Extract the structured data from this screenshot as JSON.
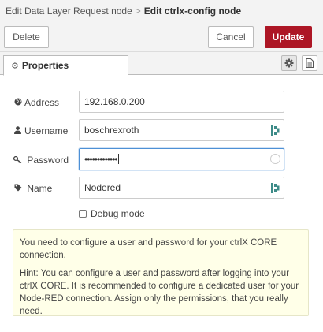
{
  "breadcrumb": {
    "parent": "Edit Data Layer Request node",
    "separator": ">",
    "current": "Edit ctrlx-config node"
  },
  "toolbar": {
    "delete_label": "Delete",
    "cancel_label": "Cancel",
    "update_label": "Update"
  },
  "tabs": {
    "properties_label": "Properties"
  },
  "form": {
    "address_label": "Address",
    "address_value": "192.168.0.200",
    "username_label": "Username",
    "username_value": "boschrexroth",
    "password_label": "Password",
    "password_value": "•••••••••••••",
    "name_label": "Name",
    "name_value": "Nodered",
    "debug_label": "Debug mode"
  },
  "info": {
    "line1": "You need to configure a user and password for your ctrlX CORE connection.",
    "line2": "Hint: You can configure a user and password after logging into your ctrlX CORE. It is recommended to configure a dedicated user for your Node-RED connection. Assign only the permissions, that you really need."
  },
  "icons": {
    "address": "globe-icon",
    "username": "user-icon",
    "password": "key-icon",
    "name": "tag-icon",
    "tab": "gear-icon",
    "settings": "gear-icon",
    "description": "document-icon",
    "field_suffix": "password-manager-icon"
  },
  "colors": {
    "accent": "#ad1625",
    "focus": "#4d90d6",
    "info_bg": "#ffffe8",
    "field_icon": "#3d8b88"
  }
}
